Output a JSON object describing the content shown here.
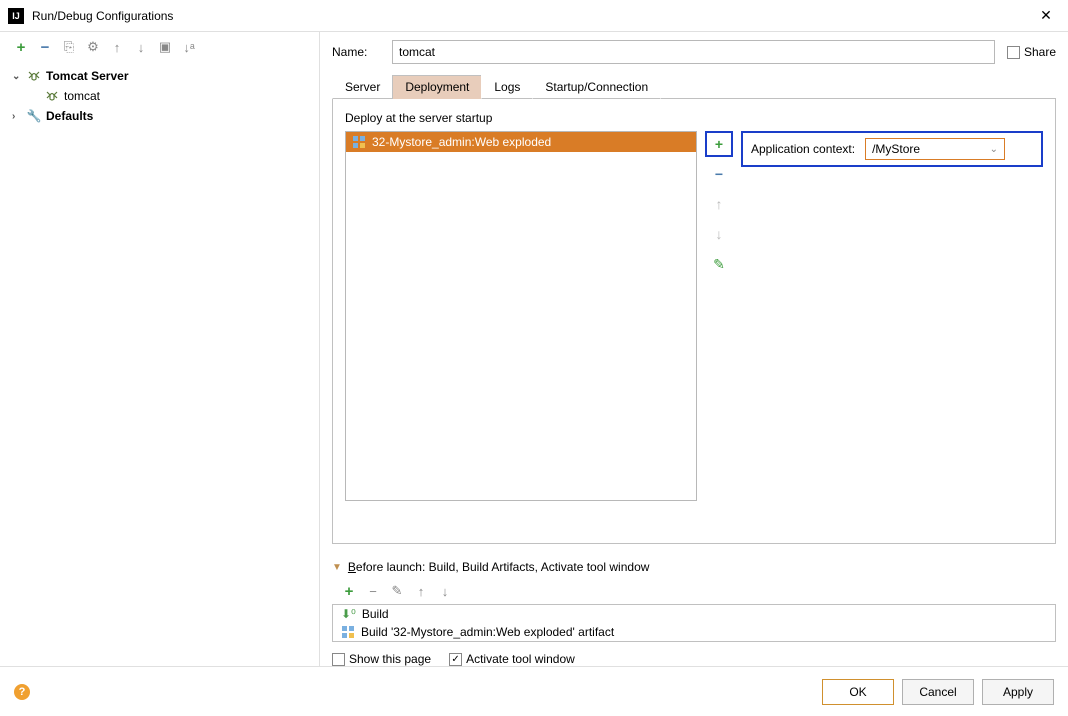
{
  "window": {
    "title": "Run/Debug Configurations"
  },
  "tree": {
    "root": "Tomcat Server",
    "child": "tomcat",
    "defaults": "Defaults"
  },
  "name_field": {
    "label": "Name:",
    "value": "tomcat",
    "share_label": "Share"
  },
  "tabs": {
    "server": "Server",
    "deployment": "Deployment",
    "logs": "Logs",
    "startup": "Startup/Connection"
  },
  "deploy": {
    "header": "Deploy at the server startup",
    "artifact": "32-Mystore_admin:Web exploded",
    "context_label": "Application context:",
    "context_value": "/MyStore"
  },
  "before_launch": {
    "header_prefix": "B",
    "header_rest": "efore launch: Build, Build Artifacts, Activate tool window",
    "build": "Build",
    "build_artifact": "Build '32-Mystore_admin:Web exploded' artifact"
  },
  "checks": {
    "show_page": "Show this page",
    "activate": "Activate tool window"
  },
  "footer": {
    "ok": "OK",
    "cancel": "Cancel",
    "apply": "Apply"
  }
}
